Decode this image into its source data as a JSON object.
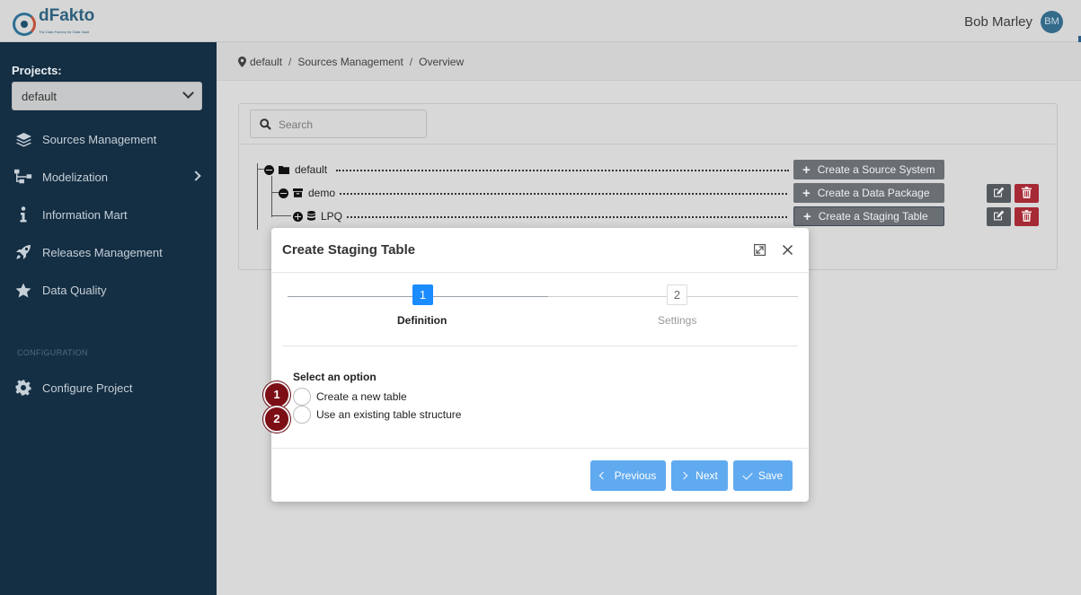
{
  "app": {
    "logo_text": "dFakto",
    "logo_tagline": "The Data Factory for Data Vault",
    "user_name": "Bob Marley",
    "user_initials": "BM"
  },
  "sidebar": {
    "projects_label": "Projects:",
    "project_selected": "default",
    "items": [
      {
        "label": "Sources Management",
        "icon": "layers-icon"
      },
      {
        "label": "Modelization",
        "icon": "sitemap-icon"
      },
      {
        "label": "Information Mart",
        "icon": "info-icon"
      },
      {
        "label": "Releases Management",
        "icon": "rocket-icon"
      },
      {
        "label": "Data Quality",
        "icon": "star-icon"
      }
    ],
    "config_section_label": "CONFIGURATION",
    "config_items": [
      {
        "label": "Configure Project",
        "icon": "gear-icon"
      }
    ]
  },
  "breadcrumb": {
    "items": [
      "default",
      "Sources Management",
      "Overview"
    ],
    "separator": "/"
  },
  "search": {
    "placeholder": "Search"
  },
  "tree": {
    "nodes": [
      {
        "label": "default",
        "icon": "folder-icon",
        "toggle": "collapse",
        "action": "Create a Source System"
      },
      {
        "label": "demo",
        "icon": "archive-icon",
        "toggle": "collapse",
        "action": "Create a Data Package"
      },
      {
        "label": "LPQ",
        "icon": "database-icon",
        "toggle": "expand",
        "action": "Create a Staging Table"
      }
    ]
  },
  "modal": {
    "title": "Create Staging Table",
    "steps": [
      {
        "number": "1",
        "label": "Definition",
        "state": "active"
      },
      {
        "number": "2",
        "label": "Settings",
        "state": "inactive"
      }
    ],
    "option_title": "Select an option",
    "options": [
      {
        "label": "Create a new table",
        "badge": "1"
      },
      {
        "label": "Use an existing table structure",
        "badge": "2"
      }
    ],
    "buttons": {
      "previous": "Previous",
      "next": "Next",
      "save": "Save"
    }
  },
  "colors": {
    "sidebar_bg": "#142e43",
    "primary_button": "#60aaf0",
    "active_step": "#1a8cff",
    "delete_button": "#a52a35",
    "badge": "#7c0e16"
  }
}
